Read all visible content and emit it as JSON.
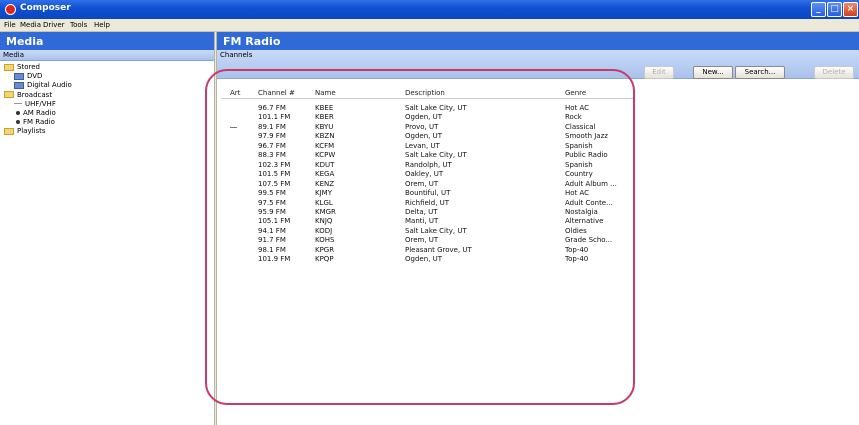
{
  "window": {
    "title": "Composer"
  },
  "menu": [
    "File",
    "Media",
    "Driver",
    "Tools",
    "Help"
  ],
  "left": {
    "header": "Media",
    "subheader": "Media",
    "tree": [
      {
        "label": "Stored",
        "kind": "folder",
        "depth": 0
      },
      {
        "label": "DVD",
        "kind": "device",
        "depth": 1
      },
      {
        "label": "Digital Audio",
        "kind": "device",
        "depth": 1
      },
      {
        "label": "Broadcast",
        "kind": "folder",
        "depth": 0
      },
      {
        "label": "UHF/VHF",
        "kind": "dash",
        "depth": 1
      },
      {
        "label": "AM Radio",
        "kind": "bullet",
        "depth": 1
      },
      {
        "label": "FM Radio",
        "kind": "bullet",
        "depth": 1
      },
      {
        "label": "Playlists",
        "kind": "folder",
        "depth": 0
      }
    ]
  },
  "main": {
    "header": "FM Radio",
    "subheader": "Channels",
    "buttons": {
      "edit": "Edit",
      "new": "New...",
      "search": "Search...",
      "delete": "Delete"
    },
    "columns": [
      "Art",
      "Channel #",
      "Name",
      "Description",
      "Genre"
    ],
    "rows": [
      {
        "channel": "96.7 FM",
        "name": "KBEE",
        "description": "Salt Lake City, UT",
        "genre": "Hot AC",
        "art": false
      },
      {
        "channel": "101.1 FM",
        "name": "KBER",
        "description": "Ogden, UT",
        "genre": "Rock",
        "art": false
      },
      {
        "channel": "89.1 FM",
        "name": "KBYU",
        "description": "Provo, UT",
        "genre": "Classical",
        "art": true
      },
      {
        "channel": "97.9 FM",
        "name": "KBZN",
        "description": "Ogden, UT",
        "genre": "Smooth Jazz",
        "art": false
      },
      {
        "channel": "96.7 FM",
        "name": "KCFM",
        "description": "Levan, UT",
        "genre": "Spanish",
        "art": false
      },
      {
        "channel": "88.3 FM",
        "name": "KCPW",
        "description": "Salt Lake City, UT",
        "genre": "Public Radio",
        "art": false
      },
      {
        "channel": "102.3 FM",
        "name": "KDUT",
        "description": "Randolph, UT",
        "genre": "Spanish",
        "art": false
      },
      {
        "channel": "101.5 FM",
        "name": "KEGA",
        "description": "Oakley, UT",
        "genre": "Country",
        "art": false
      },
      {
        "channel": "107.5 FM",
        "name": "KENZ",
        "description": "Orem, UT",
        "genre": "Adult Album ...",
        "art": false
      },
      {
        "channel": "99.5 FM",
        "name": "KJMY",
        "description": "Bountiful, UT",
        "genre": "Hot AC",
        "art": false
      },
      {
        "channel": "97.5 FM",
        "name": "KLGL",
        "description": "Richfield, UT",
        "genre": "Adult Conte...",
        "art": false
      },
      {
        "channel": "95.9 FM",
        "name": "KMGR",
        "description": "Delta, UT",
        "genre": "Nostalgia",
        "art": false
      },
      {
        "channel": "105.1 FM",
        "name": "KNJQ",
        "description": "Manti, UT",
        "genre": "Alternative",
        "art": false
      },
      {
        "channel": "94.1 FM",
        "name": "KODJ",
        "description": "Salt Lake City, UT",
        "genre": "Oldies",
        "art": false
      },
      {
        "channel": "91.7 FM",
        "name": "KOHS",
        "description": "Orem, UT",
        "genre": "Grade Scho...",
        "art": false
      },
      {
        "channel": "98.1 FM",
        "name": "KPGR",
        "description": "Pleasant Grove, UT",
        "genre": "Top-40",
        "art": false
      },
      {
        "channel": "101.9 FM",
        "name": "KPQP",
        "description": "Ogden, UT",
        "genre": "Top-40",
        "art": false
      }
    ]
  }
}
